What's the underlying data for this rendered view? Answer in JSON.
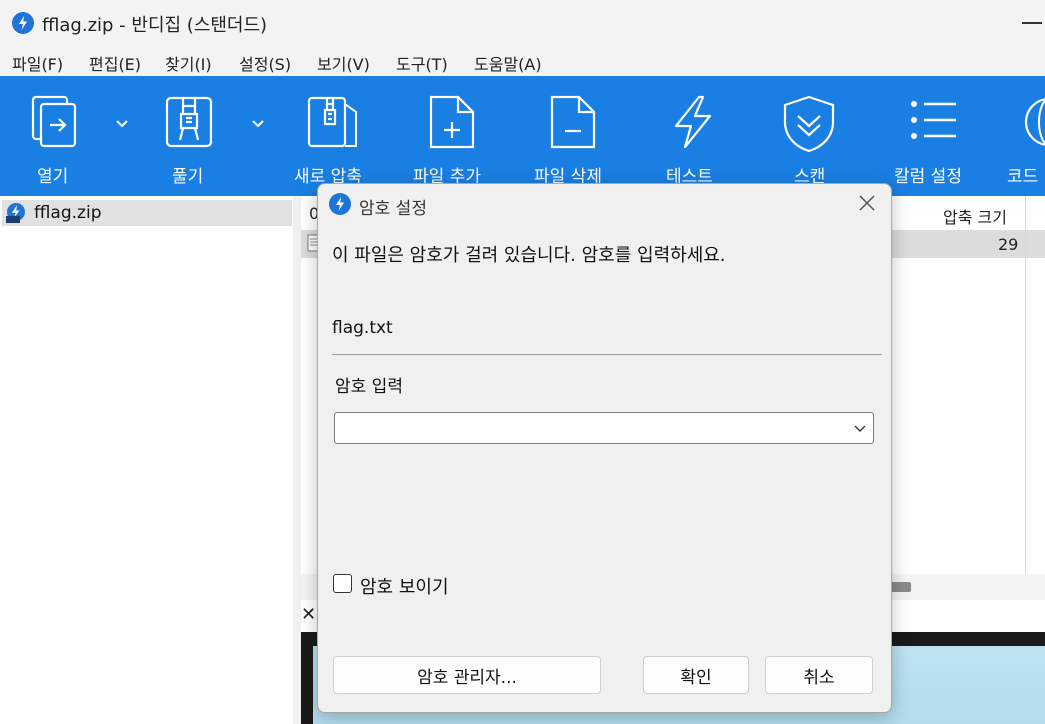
{
  "window": {
    "title": "fflag.zip - 반디집 (스탠더드)",
    "accent": "#1a7fe3"
  },
  "menu": [
    "파일(F)",
    "편집(E)",
    "찾기(I)",
    "설정(S)",
    "보기(V)",
    "도구(T)",
    "도움말(A)"
  ],
  "toolbar": [
    {
      "label": "열기",
      "icon": "open-folder-icon"
    },
    {
      "label": "풀기",
      "icon": "extract-zipper-icon"
    },
    {
      "label": "새로 압축",
      "icon": "new-archive-icon"
    },
    {
      "label": "파일 추가",
      "icon": "add-file-icon"
    },
    {
      "label": "파일 삭제",
      "icon": "delete-file-icon"
    },
    {
      "label": "테스트",
      "icon": "lightning-icon"
    },
    {
      "label": "스캔",
      "icon": "shield-icon"
    },
    {
      "label": "칼럼 설정",
      "icon": "columns-list-icon"
    },
    {
      "label": "코드",
      "icon": "globe-icon"
    }
  ],
  "tree": {
    "items": [
      {
        "label": "fflag.zip"
      }
    ]
  },
  "list": {
    "col_first": "0",
    "col_compressed": "압축 크기",
    "row_compressed": "29"
  },
  "dialog": {
    "title": "암호 설정",
    "message": "이 파일은 암호가 걸려 있습니다. 암호를 입력하세요.",
    "filename": "flag.txt",
    "password_label": "암호 입력",
    "password_value": "",
    "show_password_label": "암호 보이기",
    "show_password_checked": false,
    "manager_button": "암호 관리자...",
    "ok_button": "확인",
    "cancel_button": "취소"
  }
}
